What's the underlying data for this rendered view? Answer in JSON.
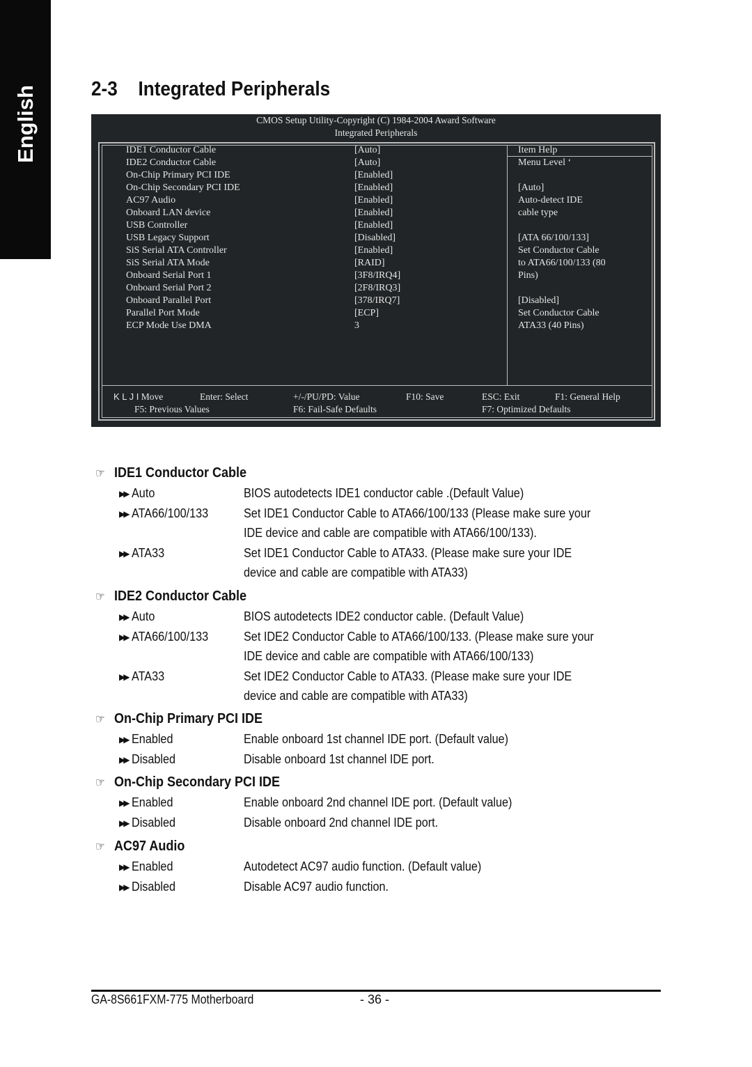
{
  "side_tab": {
    "label": "English"
  },
  "heading": {
    "number": "2-3",
    "title": "Integrated Peripherals"
  },
  "bios": {
    "header_line1": "CMOS Setup Utility-Copyright (C) 1984-2004 Award Software",
    "header_line2": "Integrated Peripherals",
    "items": [
      {
        "label": "IDE1 Conductor Cable",
        "value": "[Auto]"
      },
      {
        "label": "IDE2 Conductor Cable",
        "value": "[Auto]"
      },
      {
        "label": "On-Chip Primary PCI IDE",
        "value": "[Enabled]"
      },
      {
        "label": "On-Chip Secondary PCI IDE",
        "value": "[Enabled]"
      },
      {
        "label": "AC97 Audio",
        "value": "[Enabled]"
      },
      {
        "label": "Onboard LAN device",
        "value": "[Enabled]"
      },
      {
        "label": "USB Controller",
        "value": "[Enabled]"
      },
      {
        "label": "USB Legacy Support",
        "value": "[Disabled]"
      },
      {
        "label": "SiS Serial ATA Controller",
        "value": "[Enabled]"
      },
      {
        "label": "SiS Serial ATA Mode",
        "value": "[RAID]"
      },
      {
        "label": "Onboard Serial Port 1",
        "value": "[3F8/IRQ4]"
      },
      {
        "label": "Onboard Serial Port 2",
        "value": "[2F8/IRQ3]"
      },
      {
        "label": "Onboard Parallel Port",
        "value": "[378/IRQ7]"
      },
      {
        "label": "Parallel Port Mode",
        "value": "[ECP]"
      },
      {
        "label": "ECP Mode Use DMA",
        "value": "3"
      }
    ],
    "help": {
      "title": "Item Help",
      "lines": [
        "Menu Level    ‘",
        "",
        "[Auto]",
        "Auto-detect IDE",
        "cable type",
        "",
        "[ATA 66/100/133]",
        "Set Conductor Cable",
        "to ATA66/100/133 (80",
        "Pins)",
        "",
        "[Disabled]",
        "Set Conductor Cable",
        "ATA33 (40 Pins)"
      ]
    },
    "footer": {
      "arrows": "K L J I",
      "move": "Move",
      "enter": "Enter: Select",
      "value": "+/-/PU/PD: Value",
      "f10": "F10: Save",
      "esc": "ESC: Exit",
      "f1": "F1: General Help",
      "f5": "F5: Previous Values",
      "f6": "F6: Fail-Safe Defaults",
      "f7": "F7: Optimized Defaults"
    }
  },
  "options": [
    {
      "title": "IDE1 Conductor Cable",
      "rows": [
        {
          "value": "Auto",
          "desc": [
            "BIOS autodetects IDE1 conductor cable .(Default Value)"
          ]
        },
        {
          "value": "ATA66/100/133",
          "desc": [
            "Set IDE1 Conductor Cable to ATA66/100/133 (Please make sure your",
            "IDE device and cable are compatible with ATA66/100/133)."
          ]
        },
        {
          "value": "ATA33",
          "desc": [
            "Set IDE1 Conductor Cable to ATA33. (Please make sure your IDE",
            "device and cable are compatible with ATA33)"
          ]
        }
      ]
    },
    {
      "title": "IDE2 Conductor Cable",
      "rows": [
        {
          "value": "Auto",
          "desc": [
            "BIOS autodetects IDE2 conductor cable. (Default Value)"
          ]
        },
        {
          "value": "ATA66/100/133",
          "desc": [
            "Set IDE2 Conductor Cable to ATA66/100/133. (Please make sure your",
            "IDE device and cable are compatible with ATA66/100/133)"
          ]
        },
        {
          "value": "ATA33",
          "desc": [
            "Set IDE2 Conductor Cable to ATA33. (Please make sure your IDE",
            "device and cable are compatible with ATA33)"
          ]
        }
      ]
    },
    {
      "title": "On-Chip Primary PCI IDE",
      "rows": [
        {
          "value": "Enabled",
          "desc": [
            "Enable onboard 1st channel IDE port. (Default value)"
          ]
        },
        {
          "value": "Disabled",
          "desc": [
            "Disable onboard 1st channel IDE port."
          ]
        }
      ]
    },
    {
      "title": "On-Chip Secondary PCI IDE",
      "rows": [
        {
          "value": "Enabled",
          "desc": [
            "Enable onboard 2nd channel IDE port. (Default value)"
          ]
        },
        {
          "value": "Disabled",
          "desc": [
            "Disable onboard 2nd channel IDE port."
          ]
        }
      ]
    },
    {
      "title": "AC97 Audio",
      "rows": [
        {
          "value": "Enabled",
          "desc": [
            "Autodetect AC97 audio function. (Default value)"
          ]
        },
        {
          "value": "Disabled",
          "desc": [
            "Disable AC97 audio function."
          ]
        }
      ]
    }
  ],
  "icons": {
    "section_marker": "pointing-hand-icon",
    "option_bullet": "double-arrow-icon"
  },
  "page_footer": {
    "model": "GA-8S661FXM-775 Motherboard",
    "page": "- 36 -"
  }
}
